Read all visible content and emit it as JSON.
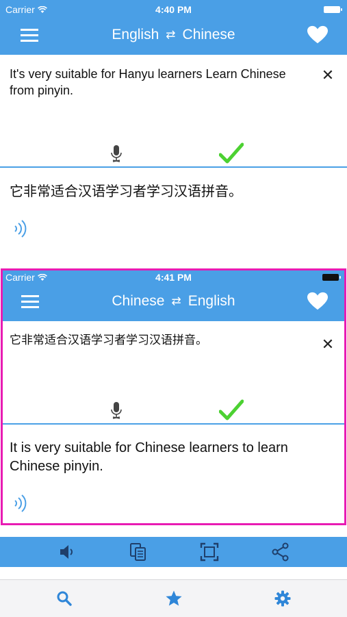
{
  "colors": {
    "accent": "#4a9fe6",
    "highlight_border": "#e81bb3",
    "check_green": "#4cd132",
    "background": "#ffffff"
  },
  "main": {
    "status": {
      "carrier": "Carrier",
      "time": "4:40 PM"
    },
    "nav": {
      "from_language": "English",
      "swap_symbol": "⇄",
      "to_language": "Chinese",
      "menu_icon": "list-icon",
      "favorite_icon": "heart-icon"
    },
    "source_text": "It's very suitable for Hanyu learners Learn Chinese from pinyin.",
    "translation_text": "它非常适合汉语学习者学习汉语拼音。"
  },
  "inset": {
    "status": {
      "carrier": "Carrier",
      "time": "4:41 PM"
    },
    "nav": {
      "from_language": "Chinese",
      "swap_symbol": "⇄",
      "to_language": "English"
    },
    "source_text": "它非常适合汉语学习者学习汉语拼音。",
    "translation_text": "It is very suitable for Chinese learners to learn Chinese pinyin."
  },
  "toolbar": {
    "icons": [
      "speaker-icon",
      "copy-icon",
      "fullscreen-icon",
      "share-icon"
    ]
  },
  "tabbar": {
    "icons": [
      "search-icon",
      "star-icon",
      "gear-icon"
    ]
  }
}
